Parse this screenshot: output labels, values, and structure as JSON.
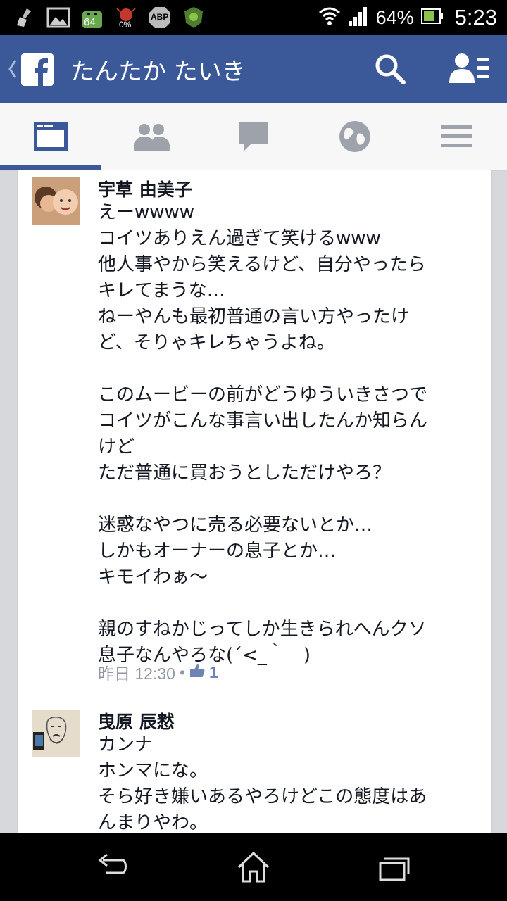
{
  "status_bar": {
    "left_icons": [
      "broom-icon",
      "gallery-icon",
      "android-64-icon",
      "bug-0-icon",
      "abp-icon",
      "shield-icon"
    ],
    "android_label": "64",
    "bug_label": "0%",
    "abp_label": "ABP",
    "battery": "64%",
    "time": "5:23"
  },
  "app_bar": {
    "title": "たんたか たいき",
    "icons": [
      "back-chevron-icon",
      "facebook-logo-icon",
      "search-icon",
      "friend-requests-icon"
    ]
  },
  "tabs": {
    "items": [
      {
        "name": "news-feed",
        "icon": "news-feed-icon",
        "active": true
      },
      {
        "name": "friends",
        "icon": "friends-icon",
        "active": false
      },
      {
        "name": "messages",
        "icon": "messages-icon",
        "active": false
      },
      {
        "name": "notifications",
        "icon": "globe-icon",
        "active": false
      },
      {
        "name": "menu",
        "icon": "menu-icon",
        "active": false
      }
    ]
  },
  "comments": [
    {
      "author": "宇草 由美子",
      "text": "えーwwww\nコイツありえん過ぎて笑けるwww\n他人事やから笑えるけど、自分やったら\nキレてまうな…\nねーやんも最初普通の言い方やったけ\nど、そりゃキレちゃうよね。\n\nこのムービーの前がどうゆういきさつで\nコイツがこんな事言い出したんか知らん\nけど\nただ普通に買おうとしただけやろ？\n\n迷惑なやつに売る必要ないとか…\nしかもオーナーの息子とか…\nキモイわぁ〜\n\n親のすねかじってしか生きられへんクソ\n息子なんやろな(´<_｀　)",
      "time": "昨日 12:30",
      "separator": "•",
      "likes": "1"
    },
    {
      "author": "曳原 辰慭",
      "text": "カンナ\nホンマにな。\nそら好き嫌いあるやろけどこの態度はあ\nんまりやわ。"
    }
  ],
  "colors": {
    "facebook_blue": "#3b5998",
    "tab_icon_gray": "#9ea3ab",
    "meta_gray": "#9197a3",
    "like_blue": "#6d84b4"
  },
  "nav_bar": {
    "icons": [
      "back-icon",
      "home-icon",
      "recent-apps-icon"
    ]
  }
}
